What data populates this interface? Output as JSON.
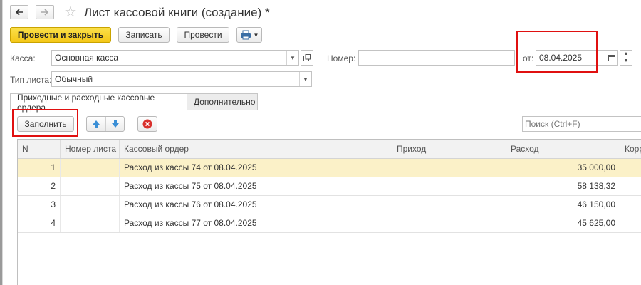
{
  "window": {
    "title": "Лист кассовой книги (создание) *"
  },
  "toolbar": {
    "post_and_close": "Провести и закрыть",
    "save": "Записать",
    "post": "Провести"
  },
  "form": {
    "kassa_label": "Касса:",
    "kassa_value": "Основная касса",
    "nomer_label": "Номер:",
    "nomer_value": "",
    "date_label": "от:",
    "date_value": "08.04.2025",
    "type_label": "Тип листа:",
    "type_value": "Обычный"
  },
  "tabs": [
    {
      "label": "Приходные и расходные кассовые ордера",
      "active": true
    },
    {
      "label": "Дополнительно",
      "active": false
    }
  ],
  "table_toolbar": {
    "fill_button": "Заполнить",
    "search_placeholder": "Поиск (Ctrl+F)"
  },
  "table": {
    "columns": [
      "N",
      "Номер листа",
      "Кассовый ордер",
      "Приход",
      "Расход",
      "Корр"
    ],
    "rows": [
      {
        "n": "1",
        "sheet": "",
        "order": "Расход из кассы 74 от 08.04.2025",
        "income": "",
        "expense": "35 000,00"
      },
      {
        "n": "2",
        "sheet": "",
        "order": "Расход из кассы 75 от 08.04.2025",
        "income": "",
        "expense": "58 138,32"
      },
      {
        "n": "3",
        "sheet": "",
        "order": "Расход из кассы 76 от 08.04.2025",
        "income": "",
        "expense": "46 150,00"
      },
      {
        "n": "4",
        "sheet": "",
        "order": "Расход из кассы 77 от 08.04.2025",
        "income": "",
        "expense": "45 625,00"
      }
    ]
  },
  "colors": {
    "primary_button": "#f4c718",
    "selected_row": "#fbf1c8",
    "highlight_box": "#e01010"
  }
}
